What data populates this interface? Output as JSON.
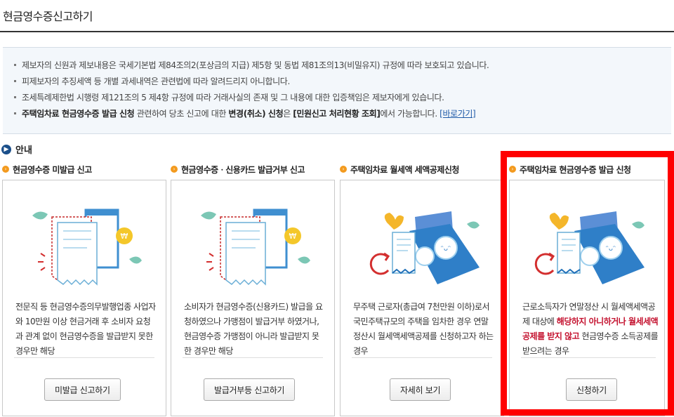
{
  "page": {
    "title": "현금영수증신고하기"
  },
  "notice": {
    "line1": "제보자의 신원과 제보내용은 국세기본법 제84조의2(포상금의 지급) 제5항 및 동법 제81조의13(비밀유지) 규정에 따라 보호되고 있습니다.",
    "line2": "피제보자의 추징세액 등 개별 과세내역은 관련법에 따라 알려드리지 아니합니다.",
    "line3": "조세특례제한법 시행령 제121조의 5 제4항 규정에 따라 거래사실의 존재 및 그 내용에 대한 입증책임은 제보자에게 있습니다.",
    "line4_bold1": "주택임차료 현금영수증 발급 신청",
    "line4_mid1": " 관련하여 당초 신고에 대한 ",
    "line4_bold2": "변경(취소) 신청",
    "line4_mid2": "은 ",
    "line4_bold3": "[민원신고 처리현황 조회]",
    "line4_end": "에서 가능합니다. ",
    "line4_link": "[바로가기]"
  },
  "section": {
    "label": "안내"
  },
  "cards": [
    {
      "title": "현금영수증 미발급 신고",
      "desc": "전문직 등 현금영수증의무발행업종 사업자와 10만원 이상 현금거래 후 소비자 요청과 관계 없이 현금영수증을 발급받지 못한 경우만 해당",
      "button": "미발급 신고하기"
    },
    {
      "title": "현금영수증ㆍ신용카드 발급거부 신고",
      "desc": "소비자가 현금영수증(신용카드) 발급을 요청하였으나 가맹점이 발급거부 하였거나, 현금영수증 가맹점이 아니라 발급받지 못한 경우만 해당",
      "button": "발급거부등 신고하기"
    },
    {
      "title": "주택임차료 월세액 세액공제신청",
      "desc": "무주택 근로자(총급여 7천만원 이하)로서 국민주택규모의 주택을 임차한 경우 연말정산시 월세액세액공제를 신청하고자 하는 경우",
      "button": "자세히 보기"
    },
    {
      "title": "주택임차료 현금영수증 발급 신청",
      "desc_pre": "근로소득자가 연말정산 시 월세액세액공제 대상에 ",
      "desc_hl": "해당하지 아니하거나 월세세액공제를 받지 않고",
      "desc_post": " 현금영수증 소득공제를 받으려는 경우",
      "button": "신청하기"
    }
  ],
  "colors": {
    "accent_red": "#ff0000",
    "highlight_text": "#c4122f",
    "link_blue": "#1e5aa8",
    "section_icon_navy": "#1b4f8a",
    "bullet_orange": "#f39a1e"
  }
}
